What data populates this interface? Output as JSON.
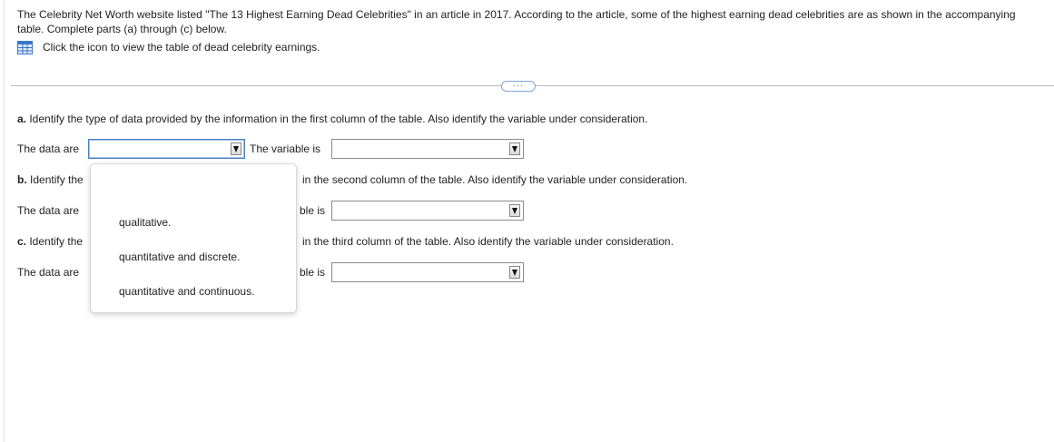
{
  "intro": {
    "text": "The Celebrity Net Worth website listed \"The 13 Highest Earning Dead Celebrities\" in an article in 2017. According to the article, some of the highest earning dead celebrities are as shown in the accompanying table. Complete parts (a) through (c) below."
  },
  "table_link": {
    "icon": "table-grid-icon",
    "text": "Click the icon to view the table of dead celebrity earnings."
  },
  "divider": {
    "more_label": "···"
  },
  "part_a": {
    "question_label": "a.",
    "question_text": " Identify the type of data provided by the information in the first column of the table. Also identify the variable under consideration.",
    "data_are_label": "The data are",
    "variable_label": "The variable is",
    "data_type_value": "",
    "variable_value": ""
  },
  "part_b": {
    "question_label": "b.",
    "question_start": " Identify the",
    "question_end": "in the second column of the table. Also identify the variable under consideration.",
    "data_are_label": "The data are",
    "variable_label_partial": "ble is",
    "variable_value": ""
  },
  "part_c": {
    "question_label": "c.",
    "question_start": " Identify the",
    "question_end": "in the third column of the table. Also identify the variable under consideration.",
    "data_are_label": "The data are",
    "variable_label_partial": "ble is",
    "variable_value": ""
  },
  "dropdown": {
    "options": [
      "qualitative.",
      "quantitative and discrete.",
      "quantitative and continuous."
    ]
  },
  "colors": {
    "focus_border": "#4a7fc0",
    "icon_blue": "#3a78c9",
    "link_button": "#7fa7d8"
  }
}
